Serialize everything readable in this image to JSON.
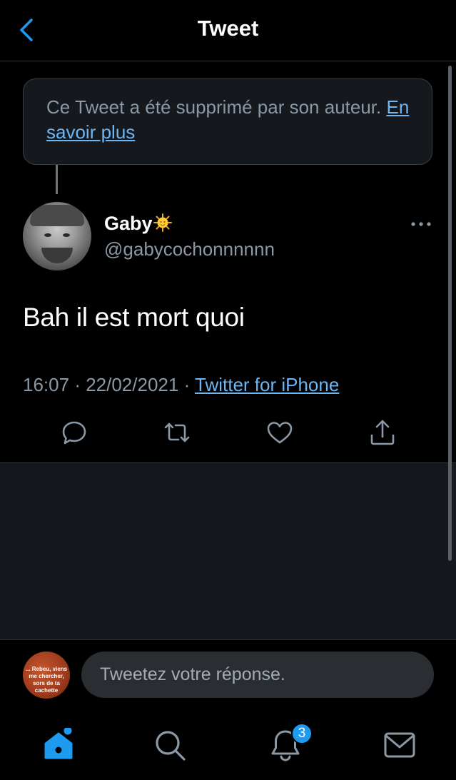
{
  "header": {
    "title": "Tweet"
  },
  "deleted_notice": {
    "text": "Ce Tweet a été supprimé par son auteur.",
    "link": "En savoir plus"
  },
  "tweet": {
    "author_name": "Gaby",
    "handle": "@gabycochonnnnnn",
    "text": "Bah il est mort quoi",
    "time": "16:07",
    "date": "22/02/2021",
    "source": "Twitter for iPhone"
  },
  "reply": {
    "avatar_caption": "... Rebeu, viens me chercher, sors de ta cachette",
    "placeholder": "Tweetez votre réponse."
  },
  "tab_bar": {
    "notifications_count": "3"
  },
  "colors": {
    "accent": "#1d9bf0",
    "link": "#6bb6f5",
    "background": "#000000",
    "secondary_text": "#8b98a5"
  }
}
